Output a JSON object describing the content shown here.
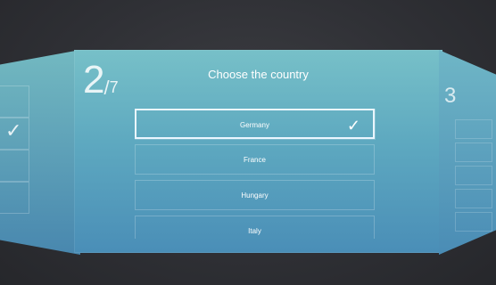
{
  "main": {
    "step_current": "2",
    "step_separator": "/",
    "step_total": "7",
    "title": "Choose the country",
    "options": [
      {
        "label": "Germany",
        "selected": true
      },
      {
        "label": "France",
        "selected": false
      },
      {
        "label": "Hungary",
        "selected": false
      },
      {
        "label": "Italy",
        "selected": false
      }
    ],
    "selected_check_icon": "checkmark-icon"
  },
  "side_left": {
    "check_icon": "checkmark-icon"
  },
  "side_right": {
    "step_current": "3"
  },
  "colors": {
    "panel_top": "#77c0c8",
    "panel_bottom": "#4a8eb7",
    "background": "#2f3035",
    "text": "#ffffff"
  }
}
